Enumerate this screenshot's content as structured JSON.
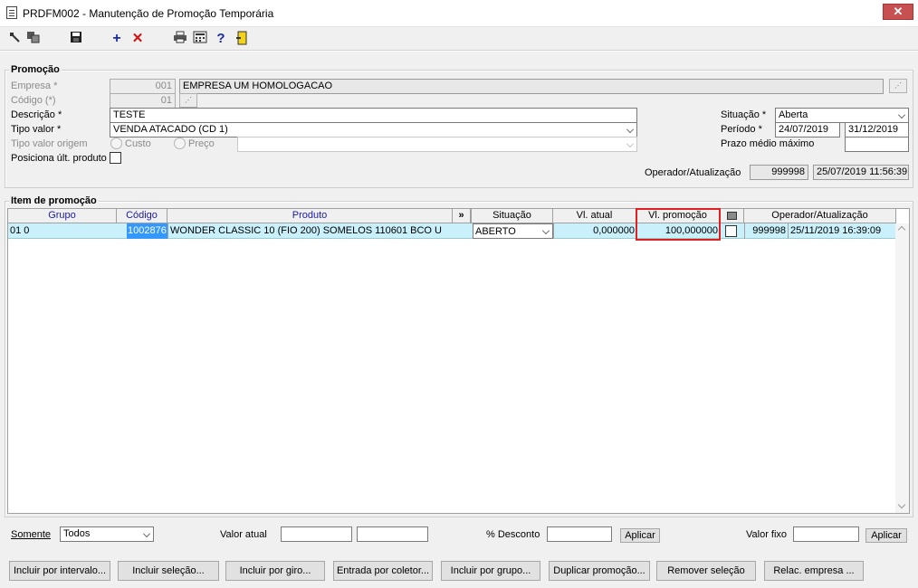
{
  "window": {
    "title": "PRDFM002 - Manutenção de Promoção Temporária",
    "close": "✕"
  },
  "promocao": {
    "title": "Promoção",
    "empresa_label": "Empresa *",
    "empresa_code": "001",
    "empresa_name": "EMPRESA UM  HOMOLOGACAO",
    "codigo_label": "Código (*)",
    "codigo_value": "01",
    "descricao_label": "Descrição *",
    "descricao_value": "TESTE",
    "tipo_valor_label": "Tipo valor *",
    "tipo_valor_value": "VENDA ATACADO (CD 1)",
    "tipo_valor_origem_label": "Tipo valor origem",
    "custo_label": "Custo",
    "preco_label": "Preço",
    "posiciona_label": "Posiciona últ. produto",
    "situacao_label": "Situação *",
    "situacao_value": "Aberta",
    "periodo_label": "Período *",
    "periodo_inicio": "24/07/2019",
    "periodo_fim": "31/12/2019",
    "prazo_label": "Prazo médio máximo",
    "operador_label": "Operador/Atualização",
    "operador_value": "999998",
    "atualizacao_value": "25/07/2019 11:56:39"
  },
  "item": {
    "title": "Item de promoção",
    "columns": {
      "grupo": "Grupo",
      "codigo": "Código",
      "produto": "Produto",
      "expand": "»",
      "situacao": "Situação",
      "vl_atual": "Vl. atual",
      "vl_promocao": "Vl. promoção",
      "operador": "Operador/Atualização"
    },
    "rows": [
      {
        "grupo": "01 0",
        "codigo": "1002876",
        "produto": "WONDER CLASSIC 10 (FIO 200) SOMELOS 110601 BCO U",
        "situacao": "ABERTO",
        "vl_atual": "0,000000",
        "vl_promocao": "100,000000",
        "operador": "999998",
        "atualizacao": "25/11/2019 16:39:09"
      }
    ]
  },
  "filters": {
    "somente_label": "Somente",
    "somente_value": "Todos",
    "valor_atual_label": "Valor atual",
    "desconto_label": "% Desconto",
    "aplicar": "Aplicar",
    "valor_fixo_label": "Valor fixo",
    "aplicar2": "Aplicar"
  },
  "buttons": [
    "Incluir por intervalo...",
    "Incluir seleção...",
    "Incluir por giro...",
    "Entrada por coletor...",
    "Incluir por grupo...",
    "Duplicar promoção...",
    "Remover seleção",
    "Relac. empresa ..."
  ],
  "colors": {
    "accent_border": "#e02020",
    "selection": "#3399ff",
    "row": "#c9f0fb"
  }
}
